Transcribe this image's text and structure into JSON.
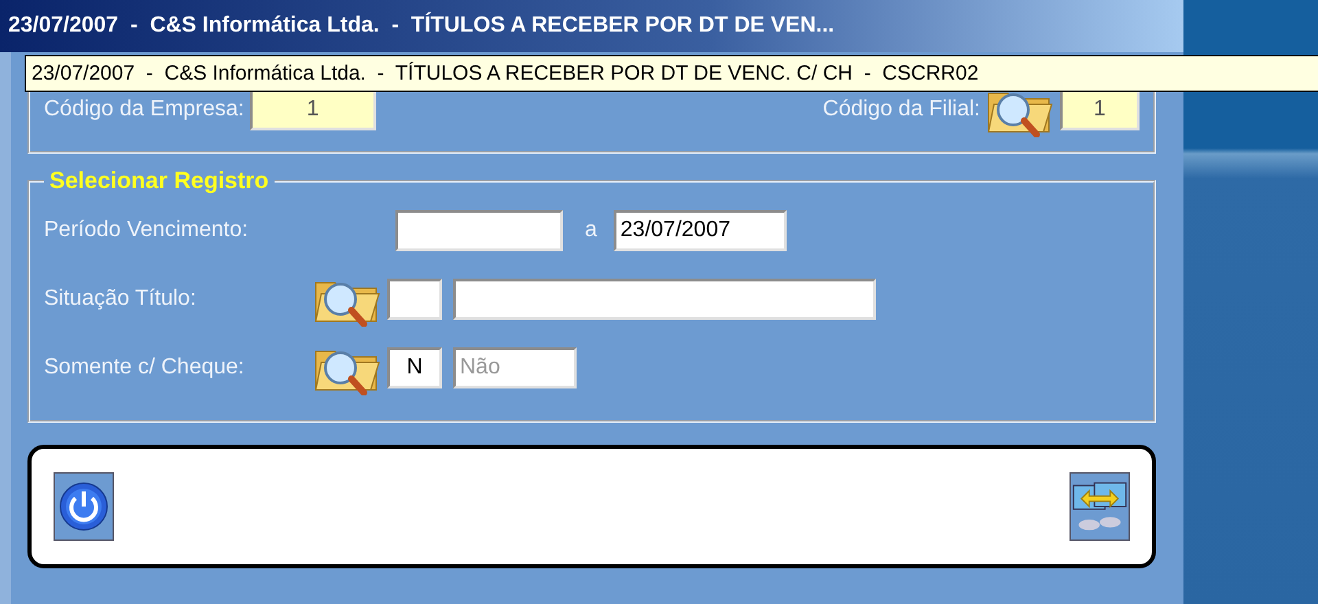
{
  "window": {
    "title": "23/07/2007  -  C&S Informática Ltda.  -  TÍTULOS A RECEBER POR DT DE VEN..."
  },
  "tooltip": {
    "text": "23/07/2007  -  C&S Informática Ltda.  -  TÍTULOS A RECEBER POR DT DE VENC. C/ CH  -  CSCRR02"
  },
  "empresa": {
    "codigo_empresa": {
      "label": "Código da Empresa:",
      "value": "1"
    },
    "codigo_filial": {
      "label": "Código da Filial:",
      "value": "1"
    }
  },
  "selecionar": {
    "title": "Selecionar Registro",
    "rows": [
      {
        "kind": "range",
        "label": "Período Vencimento:",
        "separator": "a",
        "to": "23/07/2007"
      },
      {
        "kind": "lookup",
        "label": "Situação Título:"
      },
      {
        "kind": "lookup",
        "label": "Somente c/ Cheque:",
        "code": "N",
        "description": "Não",
        "description_disabled": true
      }
    ]
  },
  "toolbar": {
    "buttons": [
      {
        "kind": "power"
      },
      {
        "kind": "transfer"
      }
    ]
  }
}
